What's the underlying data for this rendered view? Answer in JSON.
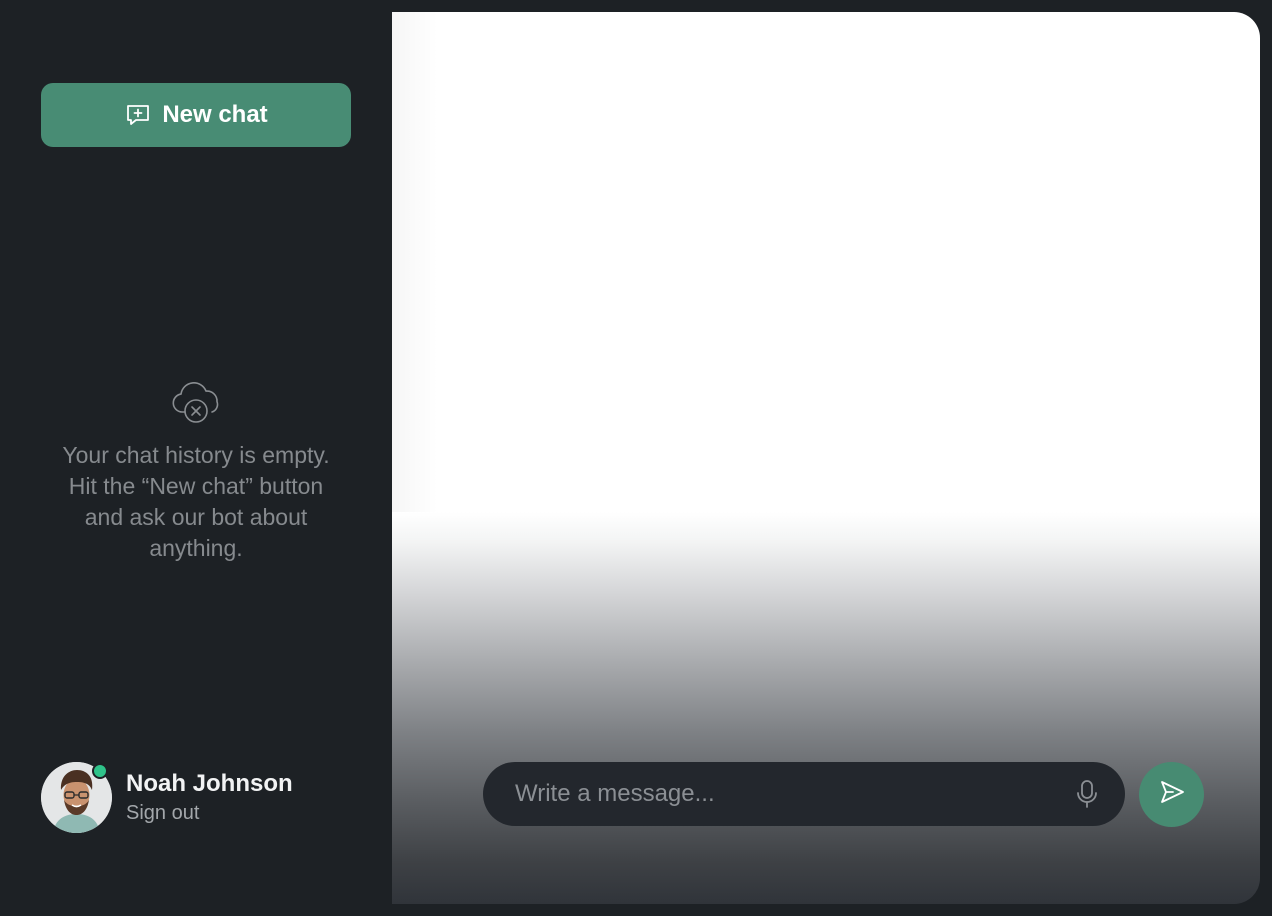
{
  "sidebar": {
    "new_chat_label": "New chat",
    "empty_state_text": "Your chat history is empty.\nHit the “New chat” button\nand ask our bot about\nanything."
  },
  "user": {
    "name": "Noah Johnson",
    "sign_out_label": "Sign out",
    "status": "online",
    "status_color": "#2fc38a"
  },
  "composer": {
    "placeholder": "Write a message...",
    "value": ""
  },
  "icons": {
    "new_chat": "chat-plus-icon",
    "empty_history": "cloud-x-icon",
    "mic": "microphone-icon",
    "send": "send-icon"
  },
  "colors": {
    "accent": "#488c74",
    "sidebar_bg": "#1d2125",
    "composer_bg": "#23272d"
  }
}
